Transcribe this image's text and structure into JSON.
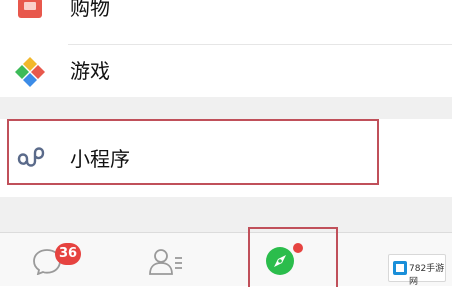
{
  "discover_list": {
    "shopping": {
      "label": "购物",
      "icon": "shopping-bag-icon"
    },
    "games": {
      "label": "游戏",
      "icon": "games-icon"
    },
    "mini_programs": {
      "label": "小程序",
      "icon": "mini-program-icon"
    }
  },
  "tabbar": {
    "chats_badge": "36",
    "tabs": [
      {
        "icon": "chat-bubble-icon"
      },
      {
        "icon": "contacts-icon"
      },
      {
        "icon": "discover-compass-icon",
        "active": true,
        "has_dot": true
      }
    ]
  },
  "colors": {
    "highlight": "#c0505a",
    "badge": "#e64340",
    "active_tab": "#2bbd4c"
  }
}
